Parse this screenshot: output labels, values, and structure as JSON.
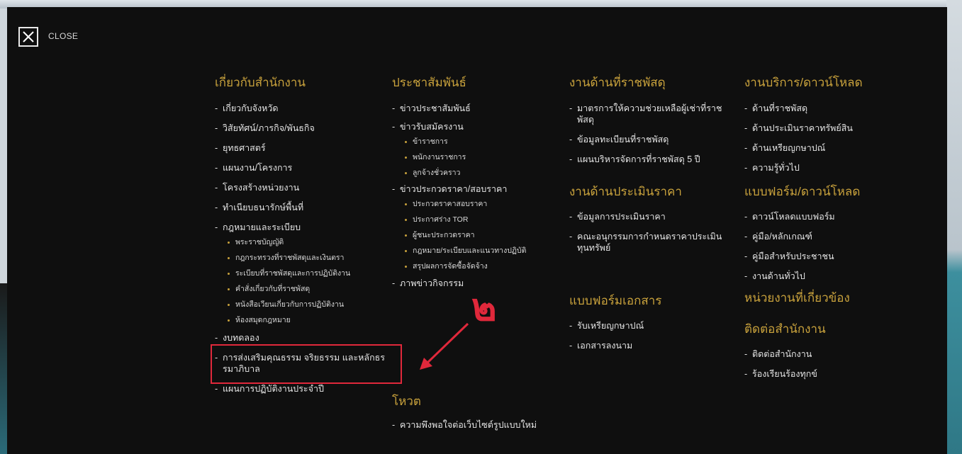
{
  "close": {
    "label": "CLOSE"
  },
  "columns": [
    {
      "sections": [
        {
          "title": "เกี่ยวกับสำนักงาน",
          "items": [
            {
              "label": "เกี่ยวกับจังหวัด"
            },
            {
              "label": "วิสัยทัศน์/ภารกิจ/พันธกิจ"
            },
            {
              "label": "ยุทธศาสตร์"
            },
            {
              "label": "แผนงาน/โครงการ"
            },
            {
              "label": "โครงสร้างหน่วยงาน"
            },
            {
              "label": "ทำเนียบธนารักษ์พื้นที่"
            },
            {
              "label": "กฎหมายและระเบียบ",
              "children": [
                "พระราชบัญญัติ",
                "กฎกระทรวงที่ราชพัสดุและเงินตรา",
                "ระเบียบที่ราชพัสดุและการปฏิบัติงาน",
                "คำสั่งเกี่ยวกับที่ราชพัสดุ",
                "หนังสือเวียนเกี่ยวกับการปฏิบัติงาน",
                "ห้องสมุดกฎหมาย"
              ]
            },
            {
              "label": "งบทดลอง"
            },
            {
              "label": "การส่งเสริมคุณธรรม จริยธรรม และหลักธรรมาภิบาล"
            },
            {
              "label": "แผนการปฏิบัติงานประจำปี"
            }
          ]
        }
      ]
    },
    {
      "sections": [
        {
          "title": "ประชาสัมพันธ์",
          "items": [
            {
              "label": "ข่าวประชาสัมพันธ์"
            },
            {
              "label": "ข่าวรับสมัครงาน",
              "children": [
                "ข้าราชการ",
                "พนักงานราชการ",
                "ลูกจ้างชั่วคราว"
              ]
            },
            {
              "label": "ข่าวประกวดราคา/สอบราคา",
              "children": [
                "ประกวดราคาสอบราคา",
                "ประกาศร่าง TOR",
                "ผู้ชนะประกวดราคา",
                "กฎหมาย/ระเบียบและแนวทางปฏิบัติ",
                "สรุปผลการจัดซื้อจัดจ้าง"
              ]
            },
            {
              "label": "ภาพข่าวกิจกรรม"
            }
          ]
        },
        {
          "title": "โหวต",
          "items": [
            {
              "label": "ความพึงพอใจต่อเว็บไซต์รูปแบบใหม่"
            }
          ]
        }
      ]
    },
    {
      "sections": [
        {
          "title": "งานด้านที่ราชพัสดุ",
          "items": [
            {
              "label": "มาตรการให้ความช่วยเหลือผู้เช่าที่ราชพัสดุ"
            },
            {
              "label": "ข้อมูลทะเบียนที่ราชพัสดุ"
            },
            {
              "label": "แผนบริหารจัดการที่ราชพัสดุ 5 ปี"
            }
          ]
        },
        {
          "title": "งานด้านประเมินราคา",
          "items": [
            {
              "label": "ข้อมูลการประเมินราคา"
            },
            {
              "label": "คณะอนุกรรมการกำหนดราคาประเมินทุนทรัพย์"
            }
          ]
        },
        {
          "title": "แบบฟอร์มเอกสาร",
          "items": [
            {
              "label": "รับเหรียญกษาปณ์"
            },
            {
              "label": "เอกสารลงนาม"
            }
          ]
        }
      ]
    },
    {
      "sections": [
        {
          "title": "งานบริการ/ดาวน์โหลด",
          "items": [
            {
              "label": "ด้านที่ราชพัสดุ"
            },
            {
              "label": "ด้านประเมินราคาทรัพย์สิน"
            },
            {
              "label": "ด้านเหรียญกษาปณ์"
            },
            {
              "label": "ความรู้ทั่วไป"
            }
          ]
        },
        {
          "title": "แบบฟอร์ม/ดาวน์โหลด",
          "items": [
            {
              "label": "ดาวน์โหลดแบบฟอร์ม"
            },
            {
              "label": "คู่มือ/หลักเกณฑ์"
            },
            {
              "label": "คู่มือสำหรับประชาชน"
            },
            {
              "label": "งานด้านทั่วไป"
            }
          ]
        },
        {
          "title": "หน่วยงานที่เกี่ยวข้อง",
          "items": []
        },
        {
          "title": "ติดต่อสำนักงาน",
          "items": [
            {
              "label": "ติดต่อสำนักงาน"
            },
            {
              "label": "ร้องเรียนร้องทุกข์"
            }
          ]
        }
      ]
    }
  ],
  "annotation": {
    "label": "๒",
    "color": "#e0283b"
  },
  "colors": {
    "accent": "#c9a23c",
    "background": "#0f0f0f",
    "annotation": "#e0283b"
  }
}
